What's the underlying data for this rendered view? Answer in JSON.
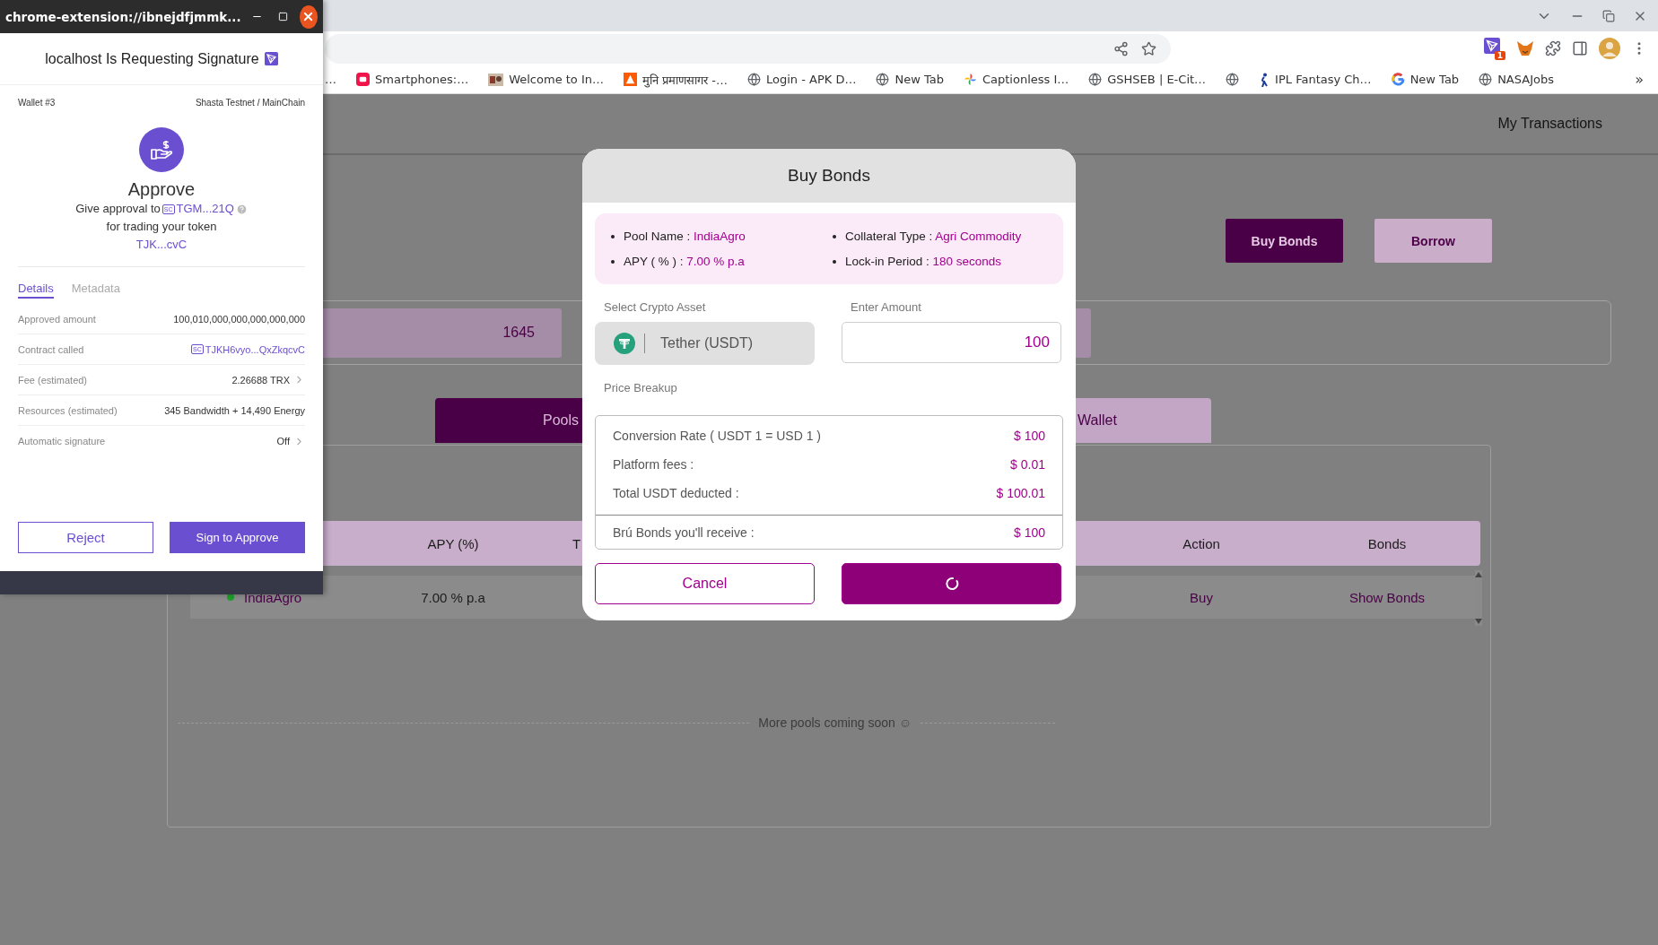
{
  "popup": {
    "title": "chrome-extension://ibnejdfjmmk...",
    "heading": "localhost Is Requesting Signature",
    "wallet": "Wallet #3",
    "network": "Shasta Testnet / MainChain",
    "action": "Approve",
    "approval_prefix": "Give approval to",
    "approval_contract": "TGM...21Q",
    "approval_suffix": "for trading your token",
    "token": "TJK...cvC",
    "tabs": [
      {
        "label": "Details",
        "selected": true
      },
      {
        "label": "Metadata",
        "selected": false
      }
    ],
    "rows": [
      {
        "label": "Approved amount",
        "value": "100,010,000,000,000,000,000",
        "kind": "plain"
      },
      {
        "label": "Contract called",
        "value": "TJKH6vyo...QxZkqcvC",
        "kind": "contract",
        "tag": "SC"
      },
      {
        "label": "Fee (estimated)",
        "value": "2.26688 TRX",
        "kind": "expandable"
      },
      {
        "label": "Resources (estimated)",
        "value": "345 Bandwidth + 14,490 Energy",
        "kind": "plain"
      },
      {
        "label": "Automatic signature",
        "value": "Off",
        "kind": "expandable"
      }
    ],
    "reject": "Reject",
    "approve": "Sign to Approve",
    "contract_tag": "SC"
  },
  "browser": {
    "bookmarks": [
      {
        "label": "…",
        "kind": "none"
      },
      {
        "label": "Smartphones:…",
        "kind": "app"
      },
      {
        "label": "Welcome to In…",
        "kind": "image"
      },
      {
        "label": "मुनि प्रमाणसागर -…",
        "kind": "orange"
      },
      {
        "label": "Login - APK D…",
        "kind": "globe"
      },
      {
        "label": "New Tab",
        "kind": "globe"
      },
      {
        "label": "Captionless I…",
        "kind": "pinwheel"
      },
      {
        "label": "GSHSEB | E-Cit…",
        "kind": "globe"
      },
      {
        "kind": "globe"
      },
      {
        "label": "IPL Fantasy Ch…",
        "kind": "figure"
      },
      {
        "label": "New Tab",
        "kind": "google"
      },
      {
        "label": "NASAJobs",
        "kind": "globe"
      }
    ],
    "more": "»",
    "extension_badge": "1"
  },
  "page": {
    "nav_link": "My Transactions",
    "actions": [
      {
        "label": "Buy Bonds",
        "kind": "primary"
      },
      {
        "label": "Borrow",
        "kind": "secondary"
      }
    ],
    "stat_value": "1645",
    "tabs": [
      {
        "label": "Pools",
        "selected": true
      },
      {
        "label": "Wallet",
        "selected": false
      }
    ],
    "table": {
      "columns": [
        "APY (%)",
        "T",
        "Action",
        "Bonds"
      ],
      "rows": [
        {
          "pool": "IndiaAgro",
          "color": "#1e9e2a",
          "apy": "7.00 % p.a",
          "action": "Buy",
          "bonds": "Show Bonds"
        }
      ]
    },
    "footer": "More pools coming soon ☺"
  },
  "modal": {
    "title": "Buy Bonds",
    "info": [
      {
        "label": "Pool Name :",
        "value": "IndiaAgro"
      },
      {
        "label": "Collateral Type :",
        "value": "Agri Commodity"
      },
      {
        "label": "APY ( % ) :",
        "value": "7.00 % p.a"
      },
      {
        "label": "Lock-in Period :",
        "value": "180 seconds"
      }
    ],
    "asset_label": "Select Crypto Asset",
    "asset": "Tether (USDT)",
    "amount_label": "Enter Amount",
    "amount": "100",
    "breakup_label": "Price Breakup",
    "breakup": [
      {
        "label": "Conversion Rate ( USDT 1 = USD 1 )",
        "value": "$ 100"
      },
      {
        "label": "Platform fees :",
        "value": "$ 0.01"
      },
      {
        "label": "Total USDT deducted :",
        "value": "$ 100.01"
      }
    ],
    "receive": {
      "label": "Brú Bonds you'll receive :",
      "value": "$ 100"
    },
    "cancel": "Cancel",
    "confirm": {
      "loading": true
    }
  }
}
